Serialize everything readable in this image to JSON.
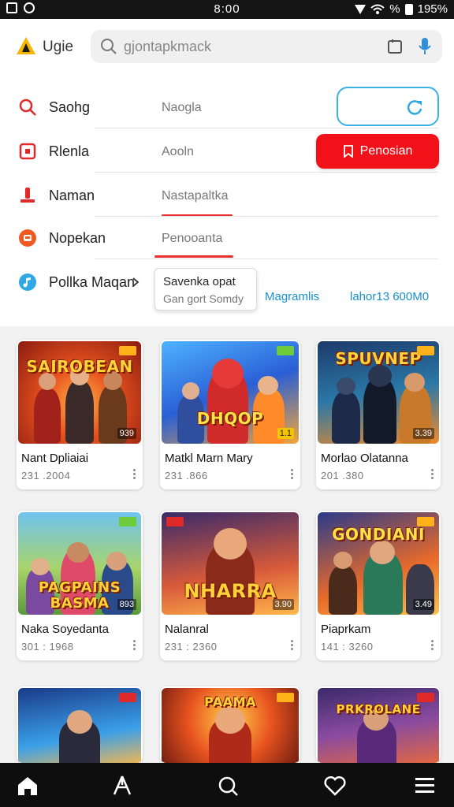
{
  "status_bar": {
    "time": "8:00",
    "battery": "195%",
    "signal_text": "%"
  },
  "header": {
    "app_name": "Ugie",
    "search_value": "gjontapkmack"
  },
  "menu": {
    "rows": [
      {
        "label": "Saohg",
        "value": "Naogla"
      },
      {
        "label": "Rlenla",
        "value": "Aooln"
      },
      {
        "label": "Naman",
        "value": "Nastapaltka"
      },
      {
        "label": "Nopekan",
        "value": "Penooanta"
      },
      {
        "label": "Pollka Maqan"
      }
    ],
    "red_button_label": "Penosian",
    "tooltip": {
      "line1": "Savenka opat",
      "line2": "Gan gort Somdy"
    },
    "link1": "Magramlis",
    "link2": "lahor13 600M0"
  },
  "games": [
    {
      "thumb_title": "SAIROBEAN",
      "name": "Nant Dpliaiai",
      "meta": "231 .2004",
      "rating": "939"
    },
    {
      "thumb_title": "DHQOP",
      "name": "Matkl Marn Mary",
      "meta": "231 .866",
      "rating": "1.1"
    },
    {
      "thumb_title": "SPUVNEP",
      "name": "Morlao Olatanna",
      "meta": "201 .380",
      "rating": "3.39"
    },
    {
      "thumb_title": "PAGPAINS BASMA",
      "name": "Naka Soyedanta",
      "meta": "301 : 1968",
      "rating": "893"
    },
    {
      "thumb_title": "NHARRA",
      "name": "Nalanral",
      "meta": "231 : 2360",
      "rating": "3.90"
    },
    {
      "thumb_title": "GONDIANI",
      "name": "Piaprkam",
      "meta": "141 : 3260",
      "rating": "3.49"
    },
    {
      "thumb_title": ""
    },
    {
      "thumb_title": "PAAMA"
    },
    {
      "thumb_title": "PRKROLANE"
    }
  ],
  "colors": {
    "accent_red": "#f21019",
    "accent_blue": "#3ab0e6",
    "link_blue": "#1a8fcf"
  },
  "icons": [
    "home-icon",
    "share-icon",
    "search-icon",
    "heart-icon",
    "menu-icon"
  ]
}
